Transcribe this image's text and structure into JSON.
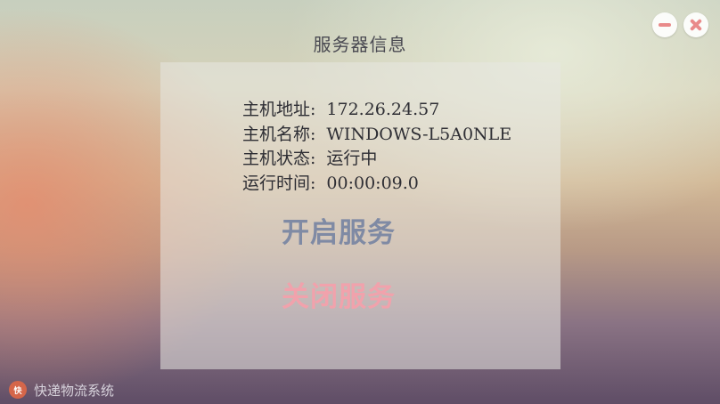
{
  "window": {
    "title": "服务器信息",
    "minimize_icon": "minimize-icon",
    "close_icon": "close-icon",
    "accent_colors": {
      "window_button_glyph": "#e98a8a",
      "start_button": "#7f8aa4",
      "stop_button": "#f1a2ac",
      "logo": "#d5664a"
    }
  },
  "server_info": {
    "rows": [
      {
        "label": "主机地址:",
        "value": "172.26.24.57"
      },
      {
        "label": "主机名称:",
        "value": "WINDOWS-L5A0NLE"
      },
      {
        "label": "主机状态:",
        "value": "运行中"
      },
      {
        "label": "运行时间:",
        "value": "00:00:09.0"
      }
    ]
  },
  "actions": {
    "start_label": "开启服务",
    "stop_label": "关闭服务"
  },
  "footer": {
    "logo_icon": "app-logo-icon",
    "logo_text": "快",
    "app_name": "快递物流系统"
  }
}
